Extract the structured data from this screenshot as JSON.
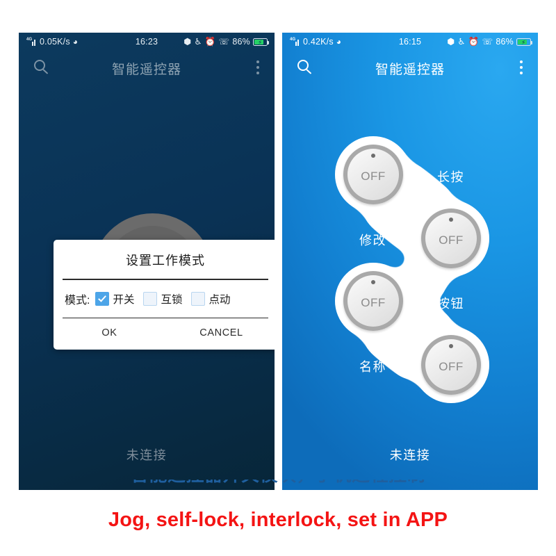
{
  "caption": "Jog, self-lock, interlock, set in APP",
  "clipped_line": "智能遥控器开关模块，手机远程控制",
  "phones": {
    "left": {
      "status_bar": {
        "network_label": "4G",
        "speed": "0.05K/s",
        "wifi_icon": "wifi-icon",
        "time": "16:23",
        "bluetooth_icon": "bluetooth-icon",
        "silent_icon": "bell-muted-icon",
        "alarm_icon": "alarm-clock-icon",
        "vibrate_icon": "vibrate-icon",
        "battery_percent": "86%",
        "battery_icon": "battery-charging-icon"
      },
      "app_bar": {
        "search_icon": "search-icon",
        "title": "智能遥控器",
        "overflow_icon": "overflow-menu-icon"
      },
      "dialog": {
        "title": "设置工作模式",
        "field_label": "模式:",
        "options": [
          {
            "label": "开关",
            "checked": true
          },
          {
            "label": "互锁",
            "checked": false
          },
          {
            "label": "点动",
            "checked": false
          }
        ],
        "ok_label": "OK",
        "cancel_label": "CANCEL"
      },
      "connection_status": "未连接"
    },
    "right": {
      "status_bar": {
        "network_label": "4G",
        "speed": "0.42K/s",
        "wifi_icon": "wifi-icon",
        "time": "16:15",
        "bluetooth_icon": "bluetooth-icon",
        "silent_icon": "bell-muted-icon",
        "alarm_icon": "alarm-clock-icon",
        "vibrate_icon": "vibrate-icon",
        "battery_percent": "86%",
        "battery_icon": "battery-charging-icon"
      },
      "app_bar": {
        "search_icon": "search-icon",
        "title": "智能遥控器",
        "overflow_icon": "overflow-menu-icon"
      },
      "buttons": [
        {
          "state": "OFF"
        },
        {
          "state": "OFF"
        },
        {
          "state": "OFF"
        },
        {
          "state": "OFF"
        }
      ],
      "pad_labels": [
        "长按",
        "修改",
        "按钮",
        "名称"
      ],
      "connection_status": "未连接"
    }
  },
  "colors": {
    "left_screen_bg": "#0a3255",
    "right_screen_bg": "#1a96e4",
    "accent_checkbox": "#4da5e8",
    "caption_red": "#f41414",
    "battery_green": "#25d065"
  }
}
